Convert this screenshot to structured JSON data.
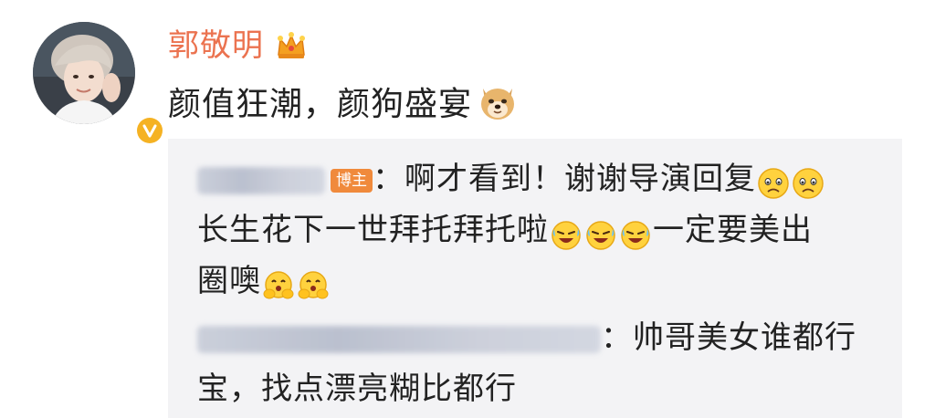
{
  "post": {
    "username": "郭敬明",
    "text": "颜值狂潮，颜狗盛宴",
    "crown_icon": "crown-icon",
    "doge_icon": "doge-emoji-icon",
    "verified_icon": "verified-v-icon"
  },
  "replies": [
    {
      "host_badge": "博主",
      "line1": "：啊才看到！谢谢导演回复",
      "line2_a": "长生花下一世拜托拜托啦",
      "line2_b": "一定要美出",
      "line3": "圈噢"
    },
    {
      "line1": "：帅哥美女谁都行",
      "line2": "宝，找点漂亮糊比都行"
    }
  ],
  "colors": {
    "username": "#eb7350",
    "reply_bg": "#f3f3f5",
    "host_badge": "#f08a3c",
    "text": "#222222"
  }
}
